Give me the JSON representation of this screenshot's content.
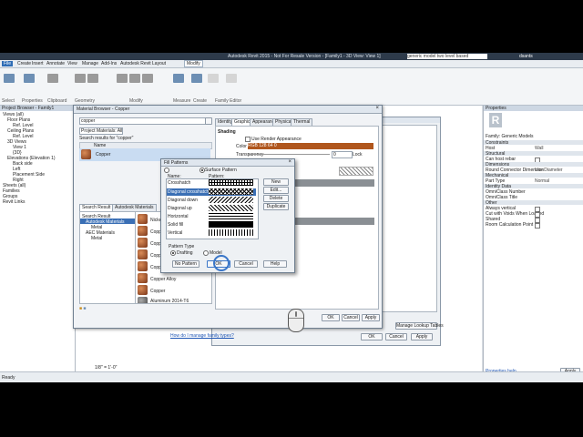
{
  "titlebar": {
    "title": "Autodesk Revit 2015 - Not For Resale Version - [Family1 - 3D View: View 1]",
    "search_placeholder": "generic model two level based",
    "user": "dsants"
  },
  "menus": [
    "File",
    "Create",
    "Insert",
    "Annotate",
    "View",
    "Manage",
    "Add-Ins",
    "Autodesk Revit Layout",
    "Modify"
  ],
  "ribbon_groups": [
    "Select",
    "Properties",
    "Clipboard",
    "Geometry",
    "Modify",
    "Measure",
    "Create",
    "Family Editor"
  ],
  "project_browser": {
    "title": "Project Browser - Family1",
    "items": [
      "Views (all)",
      "Floor Plans",
      "Ref. Level",
      "Ceiling Plans",
      "Ref. Level",
      "3D Views",
      "View 1",
      "{3D}",
      "Elevations (Elevation 1)",
      "Back side",
      "Left",
      "Placement Side",
      "Right",
      "Sheets (all)",
      "Families",
      "Groups",
      "Revit Links"
    ]
  },
  "properties": {
    "title": "Properties",
    "type": "Family: Generic Models",
    "sections": [
      "Constraints",
      "Structural",
      "Dimensions",
      "Mechanical",
      "Identity Data",
      "Other"
    ],
    "rows": [
      {
        "label": "Host",
        "value": "Wall"
      },
      {
        "label": "Can host rebar",
        "value": ""
      },
      {
        "label": "Round Connector Dimension",
        "value": "Use Diameter"
      },
      {
        "label": "Part Type",
        "value": "Normal"
      },
      {
        "label": "OmniClass Number",
        "value": ""
      },
      {
        "label": "OmniClass Title",
        "value": ""
      },
      {
        "label": "Always vertical",
        "value": ""
      },
      {
        "label": "Cut with Voids When Loaded",
        "value": ""
      },
      {
        "label": "Shared",
        "value": ""
      },
      {
        "label": "Room Calculation Point",
        "value": ""
      }
    ],
    "help_link": "Properties help",
    "apply": "Apply"
  },
  "material_browser": {
    "title": "Material Browser - Copper",
    "search_value": "copper",
    "filter": "Project Materials: All",
    "results_label": "Search results for \"copper\"",
    "column_name": "Name",
    "project_results": [
      "Copper"
    ],
    "tabs": [
      "Identity",
      "Graphics",
      "Appearance",
      "Physical",
      "Thermal"
    ],
    "shading_label": "Shading",
    "use_render_label": "Use Render Appearance",
    "color_label": "Color",
    "color_value": "RGB 128 64 0",
    "transparency_label": "Transparency",
    "transparency_value": "0",
    "lock_label": "Lock",
    "library_tabs": [
      "Search Result",
      "Autodesk Materials"
    ],
    "library_tree": [
      "Search Result",
      "Autodesk Materials",
      "Metal",
      "AEC Materials",
      "Metal"
    ],
    "library_items": [
      "Nickel",
      "Copper",
      "Copper",
      "Copper",
      "Copper",
      "Copper Alloy",
      "Copper",
      "Aluminum 2014-T6"
    ],
    "buttons": [
      "OK",
      "Cancel",
      "Apply"
    ],
    "manage_lookup": "Manage Lookup Tables",
    "help_link": "How do I manage family types?"
  },
  "fill_patterns": {
    "title": "Fill Patterns",
    "filter": "Surface Pattern",
    "col_name": "Name:",
    "col_pattern": "Pattern:",
    "patterns": [
      "Crosshatch",
      "Diagonal crosshatch",
      "Diagonal down",
      "Diagonal up",
      "Horizontal",
      "Solid fill",
      "Vertical"
    ],
    "selected": "Diagonal crosshatch",
    "side_buttons": [
      "New",
      "Edit...",
      "Delete",
      "Duplicate"
    ],
    "pattern_type_label": "Pattern Type",
    "type_options": [
      "Drafting",
      "Model"
    ],
    "bottom_buttons": [
      "No Pattern",
      "OK",
      "Cancel",
      "Help"
    ]
  },
  "statusbar": {
    "text": "Ready",
    "scale": "1/8\" = 1'-0\""
  },
  "colors": {
    "copper": "#b0561d",
    "selection": "#3a6fb5",
    "titlebar": "#2d3a4a"
  }
}
